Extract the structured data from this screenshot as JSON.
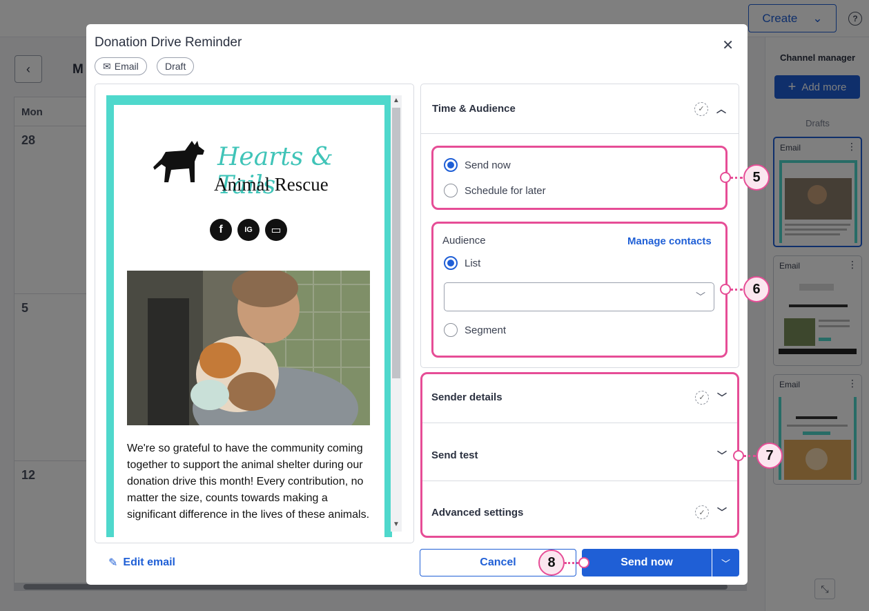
{
  "background": {
    "create_label": "Create",
    "help_label": "?",
    "calendar": {
      "month_label": "M",
      "day_header": "Mon",
      "dates": [
        "28",
        "5",
        "12"
      ]
    },
    "channel_manager": {
      "title": "Channel manager",
      "add_more_label": "Add more",
      "drafts_label": "Drafts",
      "drafts": [
        {
          "type": "Email"
        },
        {
          "type": "Email"
        },
        {
          "type": "Email"
        }
      ]
    }
  },
  "modal": {
    "title": "Donation Drive Reminder",
    "chips": [
      "Email",
      "Draft"
    ],
    "preview": {
      "logo_line1": "Hearts & Tails",
      "logo_line2": "Animal Rescue",
      "social_icons": [
        "f",
        "IG",
        "▭"
      ],
      "body_text": "We're so grateful to have the community coming together to support the animal shelter during our donation drive this month! Every contribution, no matter the size, counts towards making a significant difference in the lives of these animals."
    },
    "edit_email_label": "Edit email",
    "time_audience": {
      "header": "Time & Audience",
      "send_now": "Send now",
      "schedule_later": "Schedule for later",
      "audience_label": "Audience",
      "manage_contacts": "Manage contacts",
      "list_label": "List",
      "list_value": "",
      "segment_label": "Segment"
    },
    "sections": {
      "sender_details": "Sender details",
      "send_test": "Send test",
      "advanced_settings": "Advanced settings"
    },
    "cancel_label": "Cancel",
    "send_now_label": "Send now"
  },
  "callouts": [
    "5",
    "6",
    "7",
    "8"
  ],
  "colors": {
    "accent": "#1f5fd6",
    "highlight": "#e64d96",
    "email_border": "#4fd8cc"
  }
}
